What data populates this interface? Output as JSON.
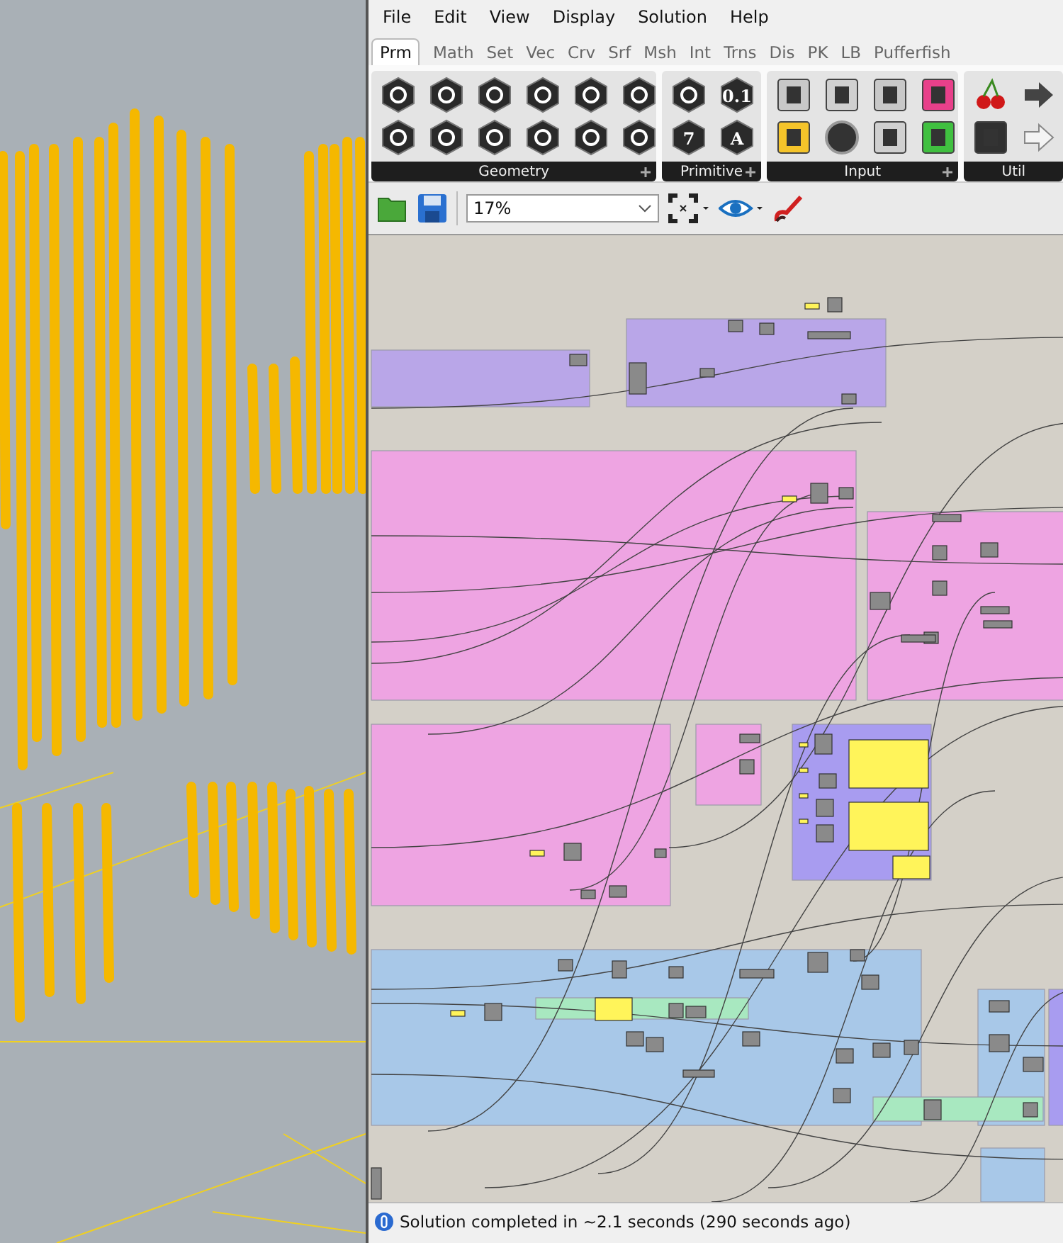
{
  "menu": [
    "File",
    "Edit",
    "View",
    "Display",
    "Solution",
    "Help"
  ],
  "tabs": [
    {
      "label": "Prm",
      "selected": true
    },
    {
      "label": "Math",
      "selected": false
    },
    {
      "label": "Set",
      "selected": false
    },
    {
      "label": "Vec",
      "selected": false
    },
    {
      "label": "Crv",
      "selected": false
    },
    {
      "label": "Srf",
      "selected": false
    },
    {
      "label": "Msh",
      "selected": false
    },
    {
      "label": "Int",
      "selected": false
    },
    {
      "label": "Trns",
      "selected": false
    },
    {
      "label": "Dis",
      "selected": false
    },
    {
      "label": "PK",
      "selected": false
    },
    {
      "label": "LB",
      "selected": false
    },
    {
      "label": "Pufferfish",
      "selected": false
    }
  ],
  "ribbon": [
    {
      "title": "Geometry",
      "expandable": true,
      "columns": [
        [
          {
            "kind": "hex"
          },
          {
            "kind": "hex"
          }
        ],
        [
          {
            "kind": "hex"
          },
          {
            "kind": "hex"
          }
        ],
        [
          {
            "kind": "hex"
          },
          {
            "kind": "hex"
          }
        ],
        [
          {
            "kind": "hex"
          },
          {
            "kind": "hex"
          }
        ],
        [
          {
            "kind": "hex"
          },
          {
            "kind": "hex"
          }
        ],
        [
          {
            "kind": "hex"
          },
          {
            "kind": "hex"
          }
        ]
      ]
    },
    {
      "title": "Primitive",
      "expandable": true,
      "columns": [
        [
          {
            "kind": "hex"
          },
          {
            "kind": "glyph",
            "glyph": "7"
          }
        ],
        [
          {
            "kind": "glyph",
            "glyph": "0.1"
          },
          {
            "kind": "glyph",
            "glyph": "A"
          }
        ]
      ]
    },
    {
      "title": "Input",
      "expandable": true,
      "columns": [
        [
          {
            "kind": "square",
            "color": "#c8c8c8"
          },
          {
            "kind": "square",
            "color": "#f5c42a"
          }
        ],
        [
          {
            "kind": "square",
            "color": "#d0d0d0"
          },
          {
            "kind": "circle"
          }
        ],
        [
          {
            "kind": "square",
            "color": "#c8c8c8"
          },
          {
            "kind": "square",
            "color": "#d0d0d0"
          }
        ],
        [
          {
            "kind": "square",
            "color": "#e8408a"
          },
          {
            "kind": "square",
            "color": "#40c040"
          }
        ]
      ]
    },
    {
      "title": "Util",
      "expandable": false,
      "columns": [
        [
          {
            "kind": "cherry"
          },
          {
            "kind": "square",
            "color": "#303030"
          }
        ],
        [
          {
            "kind": "arrow"
          },
          {
            "kind": "arrow-outline"
          }
        ]
      ]
    }
  ],
  "toolbar": {
    "zoom": "17%"
  },
  "status": "Solution completed in ~2.1 seconds (290 seconds ago)"
}
